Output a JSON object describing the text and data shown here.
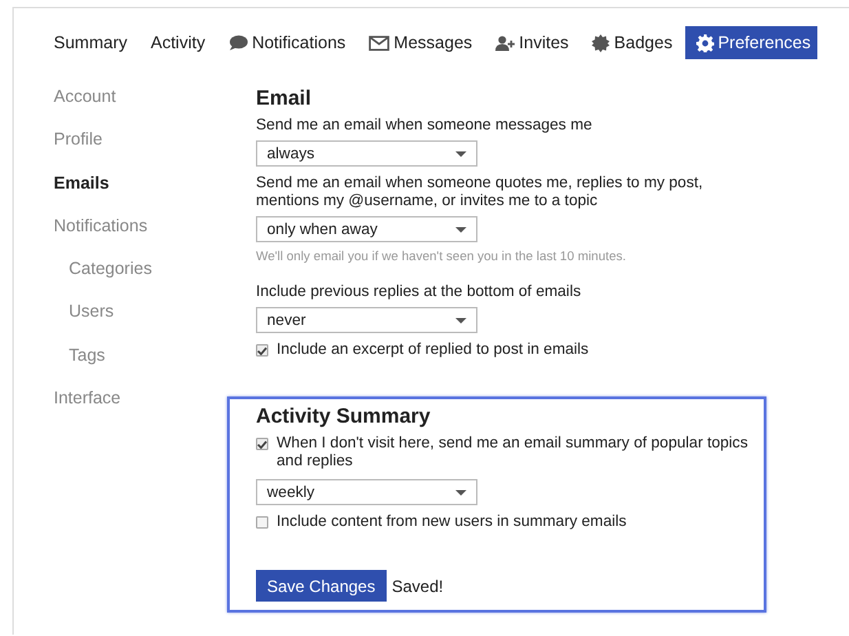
{
  "tabs": [
    {
      "label": "Summary",
      "selected": false
    },
    {
      "label": "Activity",
      "selected": false
    },
    {
      "label": "Notifications",
      "selected": false
    },
    {
      "label": "Messages",
      "selected": false
    },
    {
      "label": "Invites",
      "selected": false
    },
    {
      "label": "Badges",
      "selected": false
    },
    {
      "label": "Preferences",
      "selected": true
    }
  ],
  "sidebar": {
    "items": [
      {
        "label": "Account",
        "selected": false
      },
      {
        "label": "Profile",
        "selected": false
      },
      {
        "label": "Emails",
        "selected": true
      },
      {
        "label": "Notifications",
        "selected": false,
        "children": [
          {
            "label": "Categories",
            "selected": false
          },
          {
            "label": "Users",
            "selected": false
          },
          {
            "label": "Tags",
            "selected": false
          }
        ]
      },
      {
        "label": "Interface",
        "selected": false
      }
    ]
  },
  "sections": [
    {
      "title": "Email",
      "highlighted": false,
      "items": [
        {
          "kind": "label",
          "text": "Send me an email when someone messages me"
        },
        {
          "kind": "select",
          "value": "always"
        },
        {
          "kind": "label",
          "text": "Send me an email when someone quotes me, replies to my post, mentions my @username, or invites me to a topic"
        },
        {
          "kind": "select",
          "value": "only when away"
        },
        {
          "kind": "hint",
          "text": "We'll only email you if we haven't seen you in the last 10 minutes."
        },
        {
          "kind": "label",
          "text": "Include previous replies at the bottom of emails"
        },
        {
          "kind": "select",
          "value": "never"
        },
        {
          "kind": "checkbox",
          "text": "Include an excerpt of replied to post in emails",
          "checked": true
        }
      ]
    },
    {
      "title": "Activity Summary",
      "highlighted": true,
      "items": [
        {
          "kind": "checkbox",
          "text": "When I don't visit here, send me an email summary of popular topics and replies",
          "checked": true
        },
        {
          "kind": "select",
          "value": "weekly"
        },
        {
          "kind": "checkbox",
          "text": "Include content from new users in summary emails",
          "checked": false
        }
      ]
    }
  ],
  "save": {
    "label": "Save Changes",
    "status": "Saved!"
  }
}
